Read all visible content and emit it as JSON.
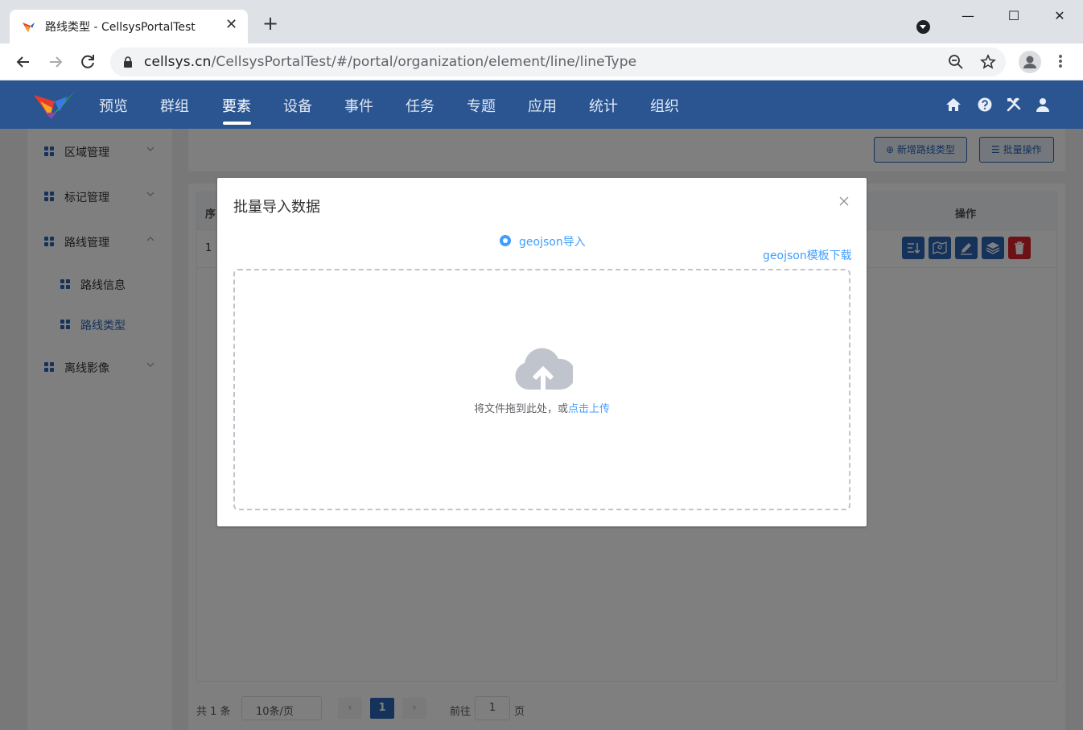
{
  "browser": {
    "tab_title": "路线类型 - CellsysPortalTest",
    "url_host": "cellsys.cn",
    "url_path": "/CellsysPortalTest/#/portal/organization/element/line/lineType"
  },
  "nav": {
    "items": [
      {
        "label": "预览"
      },
      {
        "label": "群组"
      },
      {
        "label": "要素",
        "active": true
      },
      {
        "label": "设备"
      },
      {
        "label": "事件"
      },
      {
        "label": "任务"
      },
      {
        "label": "专题"
      },
      {
        "label": "应用"
      },
      {
        "label": "统计"
      },
      {
        "label": "组织"
      }
    ]
  },
  "sidebar": {
    "items": [
      {
        "label": "区域管理"
      },
      {
        "label": "标记管理"
      },
      {
        "label": "路线管理",
        "expanded": true
      },
      {
        "label": "路线信息"
      },
      {
        "label": "路线类型",
        "active": true
      },
      {
        "label": "离线影像"
      }
    ]
  },
  "toolbar": {
    "add_label": "新增路线类型",
    "batch_label": "批量操作"
  },
  "table": {
    "headers": [
      "序",
      "操作"
    ],
    "rows": [
      {
        "index": "1"
      }
    ]
  },
  "pagination": {
    "total": "共 1 条",
    "page_size": "10条/页",
    "current_page": "1",
    "goto_prefix": "前往",
    "goto_value": "1",
    "goto_suffix": "页"
  },
  "modal": {
    "title": "批量导入数据",
    "radio_label": "geojson导入",
    "template_link": "geojson模板下载",
    "upload_text": "将文件拖到此处，或",
    "upload_link": "点击上传"
  },
  "colors": {
    "header_bg": "#2a5591",
    "primary": "#2a65b5",
    "link": "#409eff",
    "danger": "#d9232d"
  }
}
